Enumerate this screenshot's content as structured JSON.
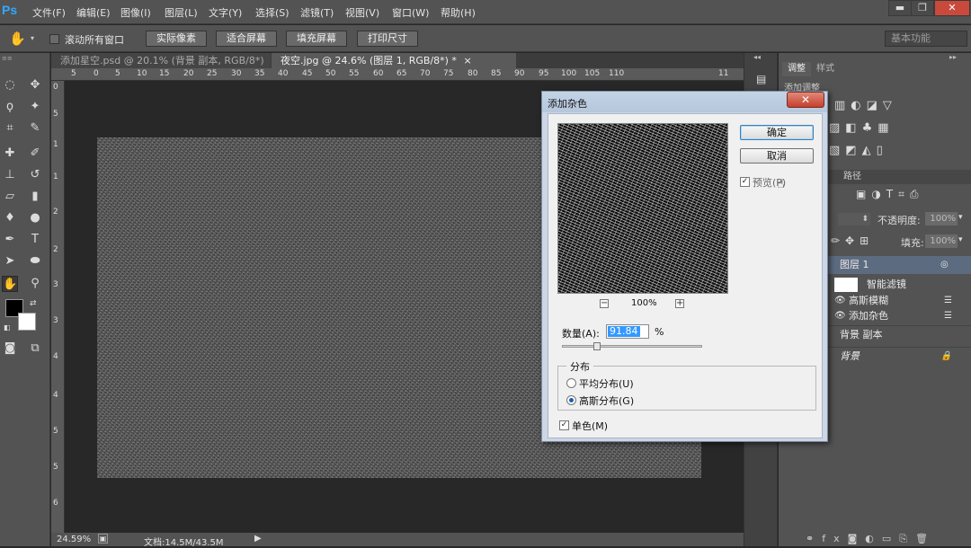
{
  "app": {
    "logo": "Ps",
    "menus": [
      "文件(F)",
      "编辑(E)",
      "图像(I)",
      "图层(L)",
      "文字(Y)",
      "选择(S)",
      "滤镜(T)",
      "视图(V)",
      "窗口(W)",
      "帮助(H)"
    ],
    "window_buttons": {
      "minimize": "▬",
      "restore": "❐",
      "close": "✕"
    }
  },
  "options_bar": {
    "scroll_all_label": "滚动所有窗口",
    "actual_pixels": "实际像素",
    "fit_screen": "适合屏幕",
    "fill_screen": "填充屏幕",
    "print_size": "打印尺寸",
    "workspace": "基本功能"
  },
  "tabs": [
    {
      "label": "添加星空.psd @ 20.1% (背景 副本, RGB/8*) *",
      "close": "×"
    },
    {
      "label": "夜空.jpg @ 24.6% (图层 1, RGB/8*) *",
      "close": "×"
    }
  ],
  "rulers": {
    "top": [
      "5",
      "0",
      "5",
      "10",
      "15",
      "20",
      "25",
      "30",
      "35",
      "40",
      "45",
      "50",
      "55",
      "60",
      "65",
      "70",
      "75",
      "80",
      "85",
      "90",
      "95",
      "100",
      "105",
      "110",
      "11"
    ],
    "left": [
      "0",
      "5",
      "1",
      "1",
      "2",
      "2",
      "3",
      "3",
      "4",
      "4",
      "5",
      "5",
      "6"
    ]
  },
  "status": {
    "zoom": "24.59%",
    "doc": "文档:14.5M/43.5M"
  },
  "right_panel": {
    "tab_adjust": "调整",
    "tab_style": "样式",
    "add_adjust": "添加调整",
    "tab_paths": "路径",
    "opacity_label": "不透明度:",
    "opacity_value": "100%",
    "fill_label": "填充:",
    "fill_value": "100%",
    "layers": {
      "layer1": "图层 1",
      "smart_filter": "智能滤镜",
      "filter1": "高斯模糊",
      "filter2": "添加杂色",
      "bg_copy": "背景 副本",
      "bg": "背景"
    }
  },
  "dialog": {
    "title": "添加杂色",
    "close": "✕",
    "ok": "确定",
    "cancel": "取消",
    "preview_label": "预览(P)",
    "zoom_value": "100%",
    "zoom_minus": "−",
    "zoom_plus": "+",
    "amount_label": "数量(A):",
    "amount_value": "91.84",
    "amount_unit": "%",
    "distribution_label": "分布",
    "uniform_label": "平均分布(U)",
    "gaussian_label": "高斯分布(G)",
    "mono_label": "单色(M)",
    "preview_checked": true,
    "gaussian_selected": true,
    "mono_checked": true
  },
  "colors": {
    "ui_gray": "#535353",
    "canvas_bg": "#282828",
    "dialog_blue": "#ccd6e4",
    "selection_blue": "#3399ff",
    "logo_blue": "#31a8ff"
  }
}
